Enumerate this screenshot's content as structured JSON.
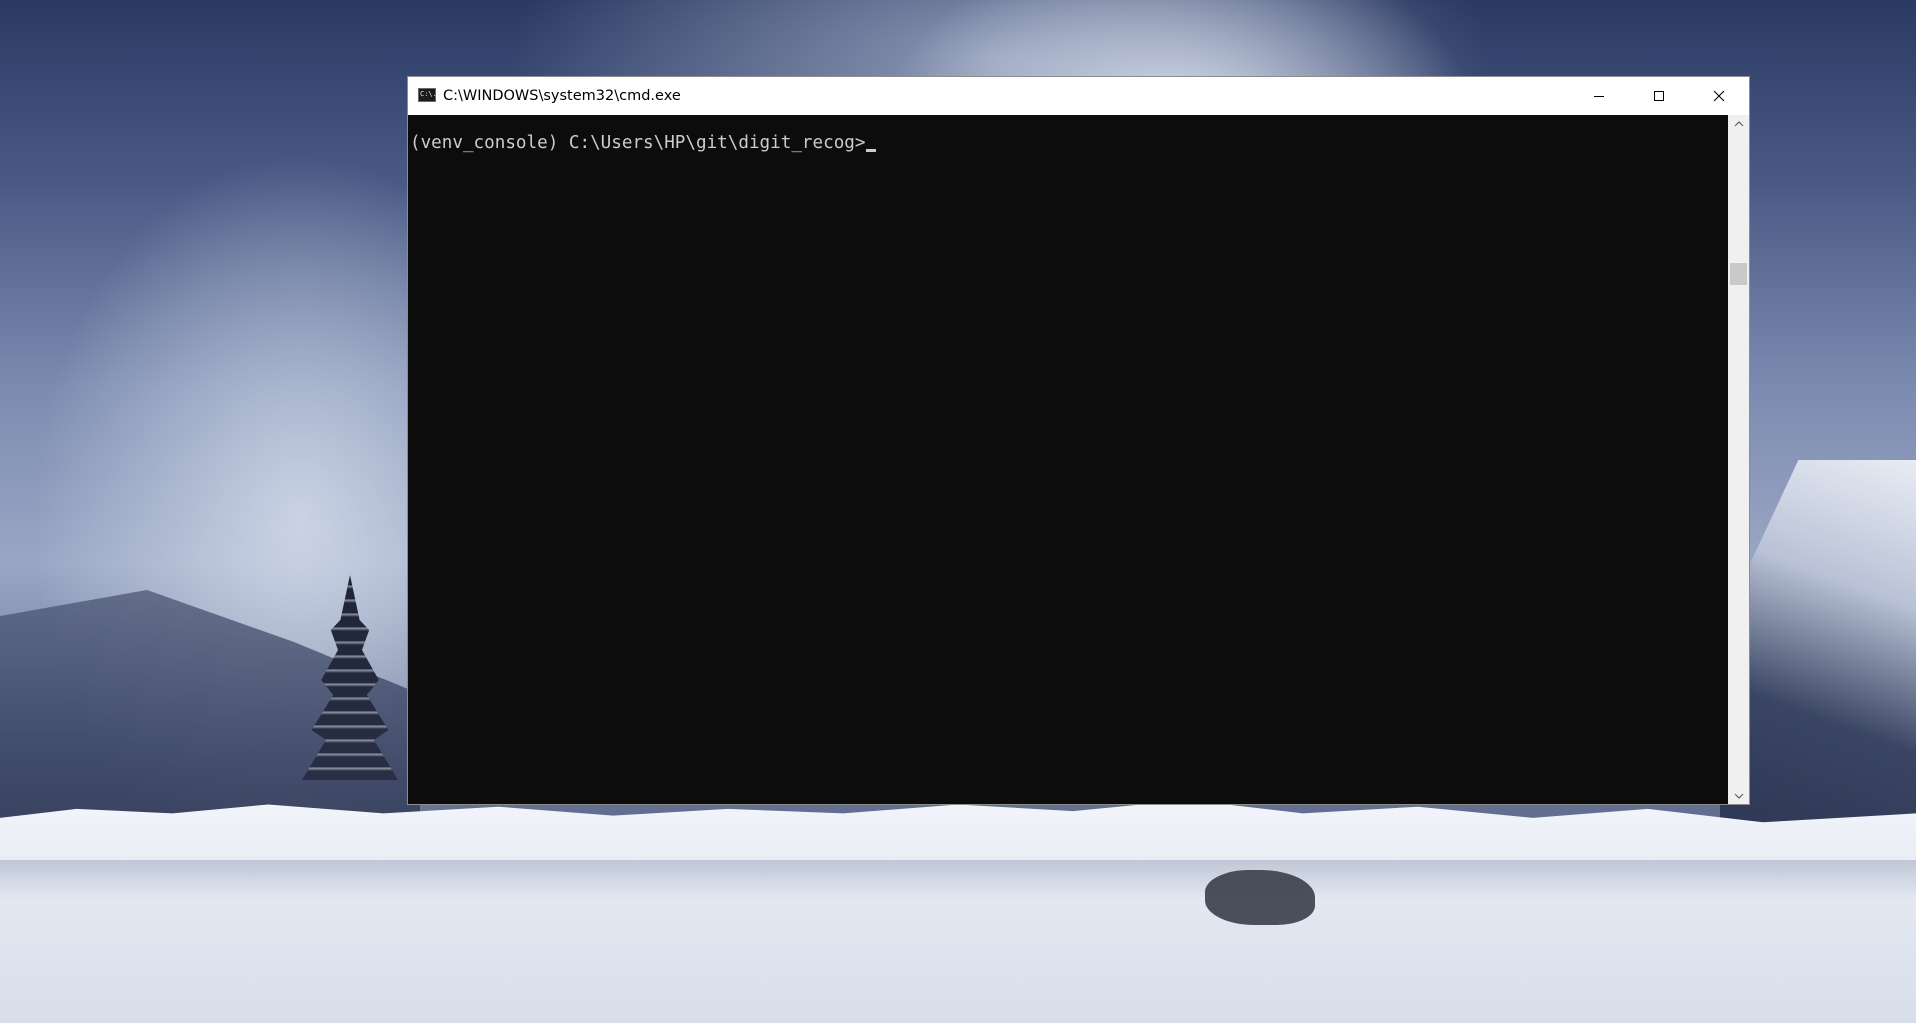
{
  "window": {
    "title": "C:\\WINDOWS\\system32\\cmd.exe",
    "icon": "cmd-app-icon",
    "icon_glyph": "C:\\."
  },
  "caption_buttons": {
    "minimize": "minimize-icon",
    "maximize": "maximize-icon",
    "close": "close-icon"
  },
  "console": {
    "prompt": "(venv_console) C:\\Users\\HP\\git\\digit_recog>",
    "text_color": "#cccccc",
    "background_color": "#0c0c0c"
  },
  "scrollbar": {
    "up": "scroll-up-arrow-icon",
    "down": "scroll-down-arrow-icon"
  },
  "desktop": {
    "wallpaper": "snowy-mountain-landscape"
  }
}
